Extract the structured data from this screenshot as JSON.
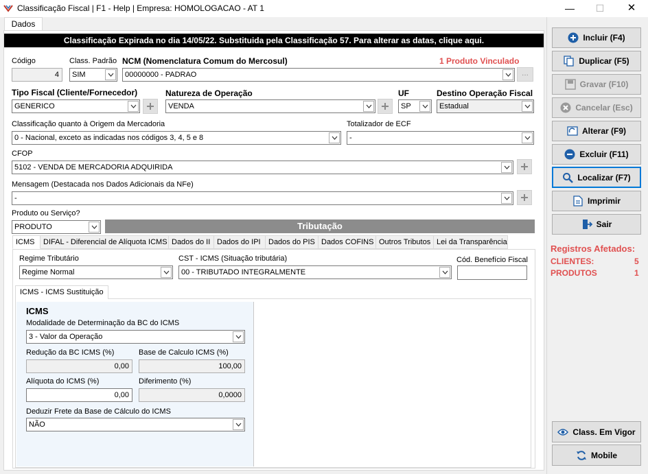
{
  "window": {
    "title": "Classificação Fiscal | F1 - Help | Empresa: HOMOLOGACAO - AT 1",
    "minimize": "—",
    "maximize": "☐",
    "close": "✕"
  },
  "tab_dados": "Dados",
  "banner": "Classificação Expirada no dia 14/05/22. Substituida pela Classificação 57. Para alterar as datas, clique aqui.",
  "fields": {
    "codigo_label": "Código",
    "codigo_value": "4",
    "class_padrao_label": "Class. Padrão",
    "class_padrao_value": "SIM",
    "ncm_label": "NCM (Nomenclatura Comum do Mercosul)",
    "ncm_value": "00000000 - PADRAO",
    "produto_vinculado": "1 Produto Vinculado",
    "ellipsis": "...",
    "tipo_fiscal_label": "Tipo Fiscal (Cliente/Fornecedor)",
    "tipo_fiscal_value": "GENERICO",
    "natureza_label": "Natureza de Operação",
    "natureza_value": "VENDA",
    "uf_label": "UF",
    "uf_value": "SP",
    "destino_label": "Destino Operação Fiscal",
    "destino_value": "Estadual",
    "origem_label": "Classificação quanto à Origem da Mercadoria",
    "origem_value": "0 - Nacional, exceto as indicadas nos códigos 3, 4, 5 e 8",
    "totalizador_label": "Totalizador de ECF",
    "totalizador_value": "-",
    "cfop_label": "CFOP",
    "cfop_value": "5102 - VENDA DE MERCADORIA ADQUIRIDA",
    "mensagem_label": "Mensagem (Destacada nos Dados Adicionais da NFe)",
    "mensagem_value": "-",
    "produto_servico_label": "Produto ou Serviço?",
    "produto_servico_value": "PRODUTO"
  },
  "tributacao_title": "Tributação",
  "tabs": [
    "ICMS",
    "DIFAL - Diferencial de Alíquota ICMS",
    "Dados do II",
    "Dados do IPI",
    "Dados do PIS",
    "Dados COFINS",
    "Outros Tributos",
    "Lei da Transparência"
  ],
  "icms": {
    "regime_label": "Regime Tributário",
    "regime_value": "Regime Normal",
    "cst_label": "CST - ICMS (Situação tributária)",
    "cst_value": "00 - TRIBUTADO INTEGRALMENTE",
    "cod_beneficio_label": "Cód. Benefício Fiscal",
    "cod_beneficio_value": "",
    "subtab": "ICMS - ICMS Sustituição",
    "section_title": "ICMS",
    "modalidade_label": "Modalidade de Determinação da BC do ICMS",
    "modalidade_value": "3 - Valor da Operação",
    "reducao_label": "Redução da BC ICMS (%)",
    "reducao_value": "0,00",
    "base_label": "Base de Calculo ICMS (%)",
    "base_value": "100,00",
    "aliquota_label": "Alíquota do ICMS (%)",
    "aliquota_value": "0,00",
    "diferimento_label": "Diferimento (%)",
    "diferimento_value": "0,0000",
    "deduzir_label": "Deduzir Frete da Base de Cálculo do ICMS",
    "deduzir_value": "NÃO"
  },
  "sidebar": {
    "incluir": "Incluir (F4)",
    "duplicar": "Duplicar (F5)",
    "gravar": "Gravar (F10)",
    "cancelar": "Cancelar (Esc)",
    "alterar": "Alterar (F9)",
    "excluir": "Excluir (F11)",
    "localizar": "Localizar (F7)",
    "imprimir": "Imprimir",
    "sair": "Sair",
    "class_em_vigor": "Class. Em Vigor",
    "mobile": "Mobile"
  },
  "registros": {
    "title": "Registros Afetados:",
    "clientes_label": "CLIENTES:",
    "clientes_value": "5",
    "produtos_label": "PRODUTOS",
    "produtos_value": "1"
  },
  "colors": {
    "accent_red": "#e05050",
    "banner_bg": "#000000",
    "tributacao_bg": "#8c8c8c",
    "focus_blue": "#0078d7",
    "icon_blue": "#1f5fa8"
  }
}
